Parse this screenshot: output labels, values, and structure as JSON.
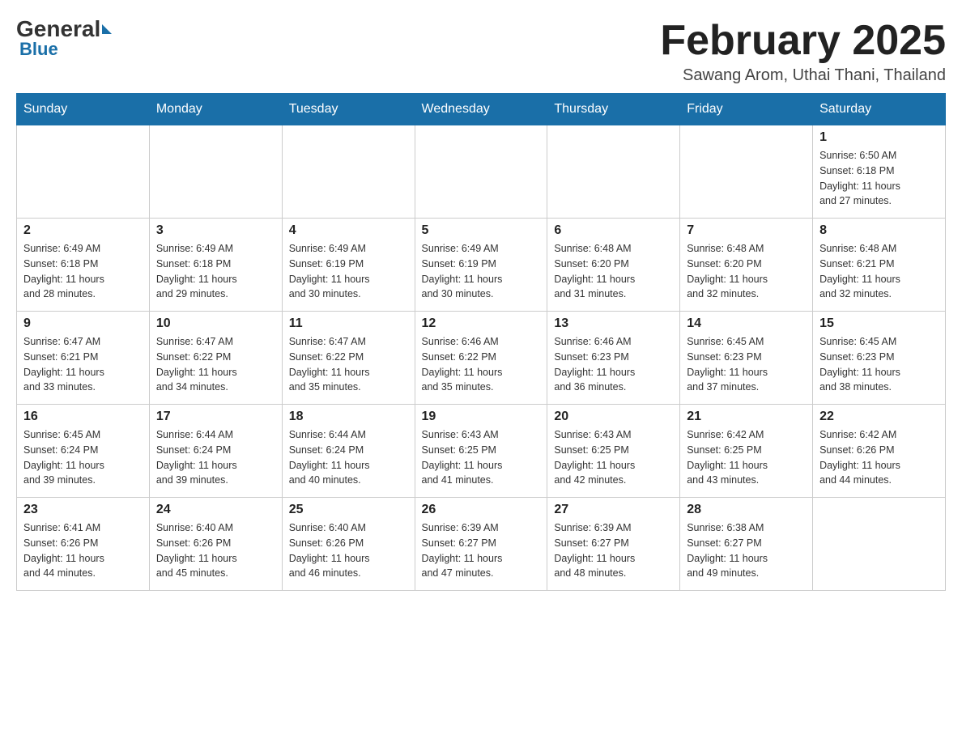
{
  "header": {
    "logo_general": "General",
    "logo_blue": "Blue",
    "month_title": "February 2025",
    "location": "Sawang Arom, Uthai Thani, Thailand"
  },
  "weekdays": [
    "Sunday",
    "Monday",
    "Tuesday",
    "Wednesday",
    "Thursday",
    "Friday",
    "Saturday"
  ],
  "weeks": [
    [
      {
        "day": "",
        "info": ""
      },
      {
        "day": "",
        "info": ""
      },
      {
        "day": "",
        "info": ""
      },
      {
        "day": "",
        "info": ""
      },
      {
        "day": "",
        "info": ""
      },
      {
        "day": "",
        "info": ""
      },
      {
        "day": "1",
        "info": "Sunrise: 6:50 AM\nSunset: 6:18 PM\nDaylight: 11 hours\nand 27 minutes."
      }
    ],
    [
      {
        "day": "2",
        "info": "Sunrise: 6:49 AM\nSunset: 6:18 PM\nDaylight: 11 hours\nand 28 minutes."
      },
      {
        "day": "3",
        "info": "Sunrise: 6:49 AM\nSunset: 6:18 PM\nDaylight: 11 hours\nand 29 minutes."
      },
      {
        "day": "4",
        "info": "Sunrise: 6:49 AM\nSunset: 6:19 PM\nDaylight: 11 hours\nand 30 minutes."
      },
      {
        "day": "5",
        "info": "Sunrise: 6:49 AM\nSunset: 6:19 PM\nDaylight: 11 hours\nand 30 minutes."
      },
      {
        "day": "6",
        "info": "Sunrise: 6:48 AM\nSunset: 6:20 PM\nDaylight: 11 hours\nand 31 minutes."
      },
      {
        "day": "7",
        "info": "Sunrise: 6:48 AM\nSunset: 6:20 PM\nDaylight: 11 hours\nand 32 minutes."
      },
      {
        "day": "8",
        "info": "Sunrise: 6:48 AM\nSunset: 6:21 PM\nDaylight: 11 hours\nand 32 minutes."
      }
    ],
    [
      {
        "day": "9",
        "info": "Sunrise: 6:47 AM\nSunset: 6:21 PM\nDaylight: 11 hours\nand 33 minutes."
      },
      {
        "day": "10",
        "info": "Sunrise: 6:47 AM\nSunset: 6:22 PM\nDaylight: 11 hours\nand 34 minutes."
      },
      {
        "day": "11",
        "info": "Sunrise: 6:47 AM\nSunset: 6:22 PM\nDaylight: 11 hours\nand 35 minutes."
      },
      {
        "day": "12",
        "info": "Sunrise: 6:46 AM\nSunset: 6:22 PM\nDaylight: 11 hours\nand 35 minutes."
      },
      {
        "day": "13",
        "info": "Sunrise: 6:46 AM\nSunset: 6:23 PM\nDaylight: 11 hours\nand 36 minutes."
      },
      {
        "day": "14",
        "info": "Sunrise: 6:45 AM\nSunset: 6:23 PM\nDaylight: 11 hours\nand 37 minutes."
      },
      {
        "day": "15",
        "info": "Sunrise: 6:45 AM\nSunset: 6:23 PM\nDaylight: 11 hours\nand 38 minutes."
      }
    ],
    [
      {
        "day": "16",
        "info": "Sunrise: 6:45 AM\nSunset: 6:24 PM\nDaylight: 11 hours\nand 39 minutes."
      },
      {
        "day": "17",
        "info": "Sunrise: 6:44 AM\nSunset: 6:24 PM\nDaylight: 11 hours\nand 39 minutes."
      },
      {
        "day": "18",
        "info": "Sunrise: 6:44 AM\nSunset: 6:24 PM\nDaylight: 11 hours\nand 40 minutes."
      },
      {
        "day": "19",
        "info": "Sunrise: 6:43 AM\nSunset: 6:25 PM\nDaylight: 11 hours\nand 41 minutes."
      },
      {
        "day": "20",
        "info": "Sunrise: 6:43 AM\nSunset: 6:25 PM\nDaylight: 11 hours\nand 42 minutes."
      },
      {
        "day": "21",
        "info": "Sunrise: 6:42 AM\nSunset: 6:25 PM\nDaylight: 11 hours\nand 43 minutes."
      },
      {
        "day": "22",
        "info": "Sunrise: 6:42 AM\nSunset: 6:26 PM\nDaylight: 11 hours\nand 44 minutes."
      }
    ],
    [
      {
        "day": "23",
        "info": "Sunrise: 6:41 AM\nSunset: 6:26 PM\nDaylight: 11 hours\nand 44 minutes."
      },
      {
        "day": "24",
        "info": "Sunrise: 6:40 AM\nSunset: 6:26 PM\nDaylight: 11 hours\nand 45 minutes."
      },
      {
        "day": "25",
        "info": "Sunrise: 6:40 AM\nSunset: 6:26 PM\nDaylight: 11 hours\nand 46 minutes."
      },
      {
        "day": "26",
        "info": "Sunrise: 6:39 AM\nSunset: 6:27 PM\nDaylight: 11 hours\nand 47 minutes."
      },
      {
        "day": "27",
        "info": "Sunrise: 6:39 AM\nSunset: 6:27 PM\nDaylight: 11 hours\nand 48 minutes."
      },
      {
        "day": "28",
        "info": "Sunrise: 6:38 AM\nSunset: 6:27 PM\nDaylight: 11 hours\nand 49 minutes."
      },
      {
        "day": "",
        "info": ""
      }
    ]
  ]
}
